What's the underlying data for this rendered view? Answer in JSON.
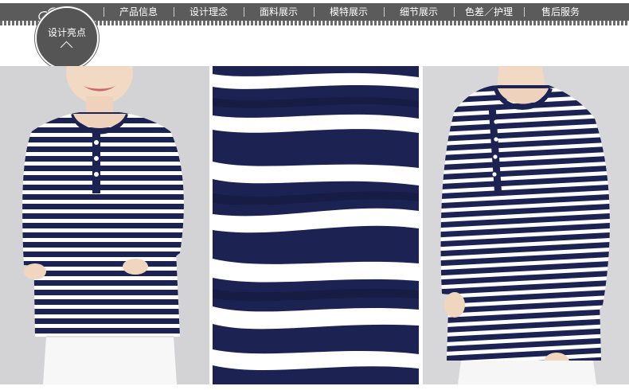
{
  "nav": {
    "items": [
      "产品信息",
      "设计理念",
      "面料展示",
      "模特展示",
      "细节展示",
      "色差／护理",
      "售后服务"
    ]
  },
  "badge": {
    "label": "设计亮点"
  },
  "colors": {
    "navy": "#1c2352",
    "white": "#ffffff",
    "nav_bg": "#5b5b5b",
    "badge_bg": "#555555",
    "photo_bg": "#d3d3d5"
  },
  "photos": [
    {
      "icon": "model-front-photo"
    },
    {
      "icon": "fabric-closeup-photo"
    },
    {
      "icon": "model-angled-photo"
    }
  ]
}
